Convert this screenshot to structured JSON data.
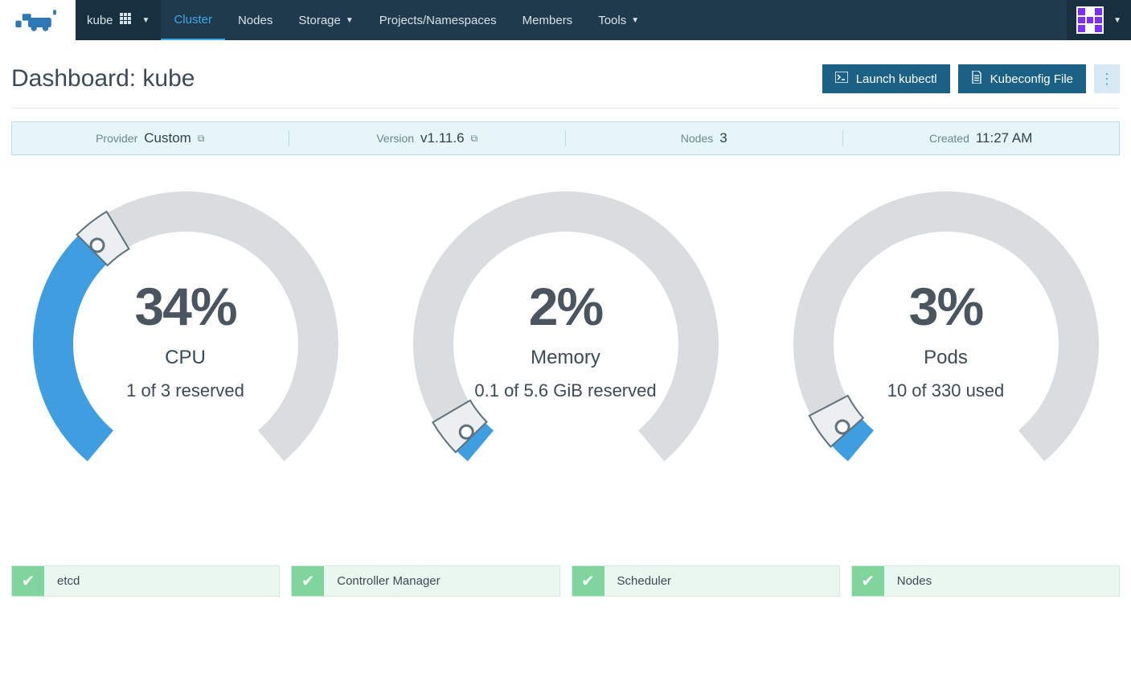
{
  "nav": {
    "cluster_name": "kube",
    "items": [
      "Cluster",
      "Nodes",
      "Storage",
      "Projects/Namespaces",
      "Members",
      "Tools"
    ],
    "dropdown_items": [
      "Storage",
      "Tools"
    ],
    "active": "Cluster"
  },
  "header": {
    "title": "Dashboard: kube",
    "launch_kubectl": "Launch kubectl",
    "kubeconfig": "Kubeconfig File"
  },
  "info": {
    "provider_label": "Provider",
    "provider_value": "Custom",
    "version_label": "Version",
    "version_value": "v1.11.6",
    "nodes_label": "Nodes",
    "nodes_value": "3",
    "created_label": "Created",
    "created_value": "11:27 AM"
  },
  "chart_data": [
    {
      "type": "gauge",
      "title": "CPU",
      "value_pct": 34,
      "value_text": "34%",
      "detail": "1 of 3 reserved"
    },
    {
      "type": "gauge",
      "title": "Memory",
      "value_pct": 2,
      "value_text": "2%",
      "detail": "0.1 of 5.6 GiB reserved"
    },
    {
      "type": "gauge",
      "title": "Pods",
      "value_pct": 3,
      "value_text": "3%",
      "detail": "10 of 330 used"
    }
  ],
  "health": [
    {
      "label": "etcd"
    },
    {
      "label": "Controller Manager"
    },
    {
      "label": "Scheduler"
    },
    {
      "label": "Nodes"
    }
  ],
  "colors": {
    "gauge_track": "#d9dde0",
    "gauge_fill": "#3f9ee0",
    "gauge_outline": "#5f717b"
  }
}
